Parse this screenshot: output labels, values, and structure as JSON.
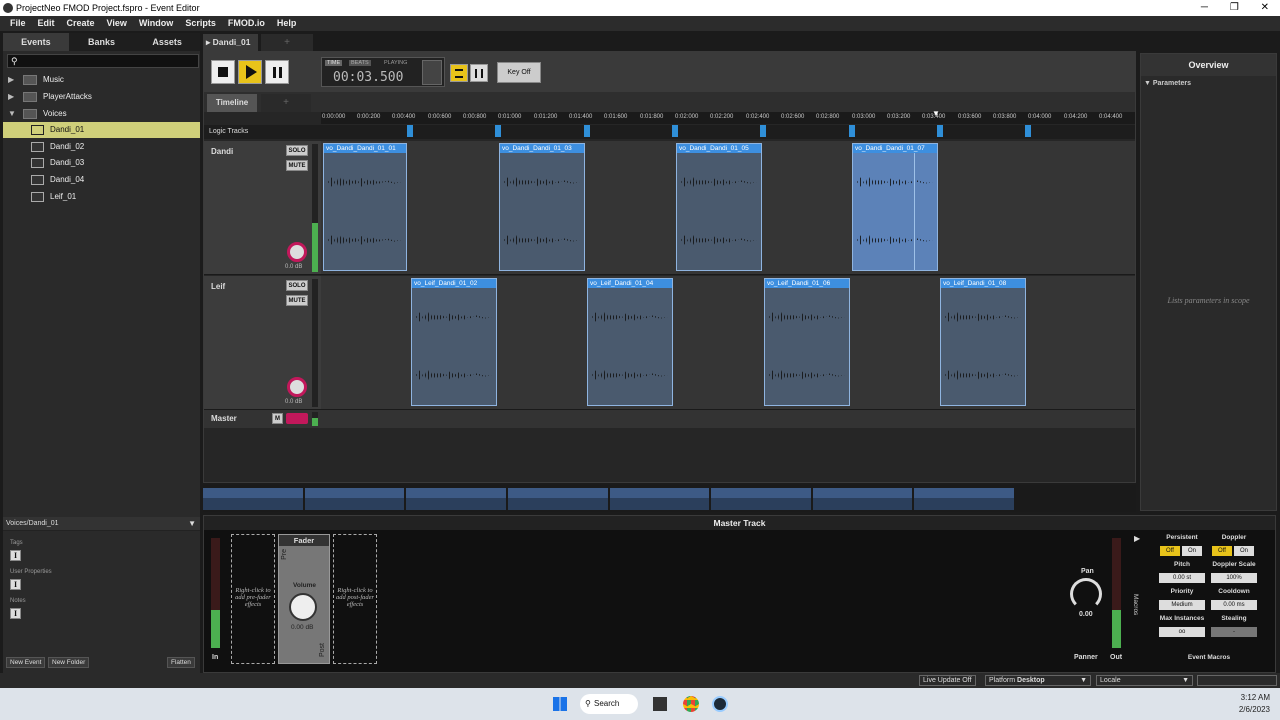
{
  "window": {
    "title": "ProjectNeo FMOD Project.fspro - Event Editor"
  },
  "menu": [
    "File",
    "Edit",
    "Create",
    "View",
    "Window",
    "Scripts",
    "FMOD.io",
    "Help"
  ],
  "browser": {
    "tabs": [
      "Events",
      "Banks",
      "Assets"
    ],
    "items": [
      {
        "label": "Music",
        "type": "folder"
      },
      {
        "label": "PlayerAttacks",
        "type": "folder"
      },
      {
        "label": "Voices",
        "type": "folder"
      },
      {
        "label": "Dandi_01",
        "type": "event"
      },
      {
        "label": "Dandi_02",
        "type": "event"
      },
      {
        "label": "Dandi_03",
        "type": "event"
      },
      {
        "label": "Dandi_04",
        "type": "event"
      },
      {
        "label": "Leif_01",
        "type": "event"
      }
    ]
  },
  "selection": {
    "path": "Voices/Dandi_01",
    "tags": "Tags",
    "user_properties": "User Properties",
    "notes": "Notes",
    "new_event": "New Event",
    "new_folder": "New Folder",
    "flatten": "Flatten"
  },
  "editor": {
    "tab": "Dandi_01",
    "add_tab": "+",
    "time_label": "TIME",
    "beats_label": "BEATS",
    "playing": "PLAYING",
    "time": "00:03.500",
    "key_off": "Key Off",
    "timeline_tab": "Timeline"
  },
  "ruler": [
    "0:00:000",
    "0:00:200",
    "0:00:400",
    "0:00:600",
    "0:00:800",
    "0:01:000",
    "0:01:200",
    "0:01:400",
    "0:01:600",
    "0:01:800",
    "0:02:000",
    "0:02:200",
    "0:02:400",
    "0:02:600",
    "0:02:800",
    "0:03:000",
    "0:03:200",
    "0:03:400",
    "0:03:600",
    "0:03:800",
    "0:04:000",
    "0:04:200",
    "0:04:400"
  ],
  "logic_tracks": "Logic Tracks",
  "tracks": [
    {
      "name": "Dandi",
      "solo": "SOLO",
      "mute": "MUTE",
      "volume": "0.0 dB",
      "clips": [
        "vo_Dandi_Dandi_01_01",
        "vo_Dandi_Dandi_01_03",
        "vo_Dandi_Dandi_01_05",
        "vo_Dandi_Dandi_01_07"
      ]
    },
    {
      "name": "Leif",
      "solo": "SOLO",
      "mute": "MUTE",
      "volume": "0.0 dB",
      "clips": [
        "vo_Leif_Dandi_01_02",
        "vo_Leif_Dandi_01_04",
        "vo_Leif_Dandi_01_06",
        "vo_Leif_Dandi_01_08"
      ]
    }
  ],
  "master": {
    "name": "Master",
    "m": "M"
  },
  "overview": {
    "title": "Overview",
    "parameters": "Parameters",
    "empty": "Lists parameters in scope"
  },
  "master_track": {
    "title": "Master Track",
    "pre_hint": "Right-click to add pre-fader effects",
    "post_hint": "Right-click to add post-fader effects",
    "fader": "Fader",
    "pre": "Pre",
    "post": "Post",
    "volume": "Volume",
    "volume_value": "0.00 dB",
    "in": "In",
    "out": "Out",
    "pan": "Pan",
    "pan_value": "0.00",
    "panner": "Panner",
    "macros": "Macros"
  },
  "macros": {
    "persistent": "Persistent",
    "doppler": "Doppler",
    "off": "Off",
    "on": "On",
    "pitch": "Pitch",
    "pitch_value": "0.00 st",
    "doppler_scale": "Doppler Scale",
    "doppler_scale_value": "100%",
    "priority": "Priority",
    "priority_value": "Medium",
    "cooldown": "Cooldown",
    "cooldown_value": "0.00 ms",
    "max_instances": "Max Instances",
    "max_value": "oo",
    "stealing": "Stealing",
    "stealing_value": "-",
    "event_macros": "Event Macros"
  },
  "status": {
    "live_update": "Live Update Off",
    "platform": "Platform",
    "platform_value": "Desktop",
    "locale": "Locale"
  },
  "taskbar": {
    "search": "Search",
    "time": "3:12 AM",
    "date": "2/6/2023"
  }
}
